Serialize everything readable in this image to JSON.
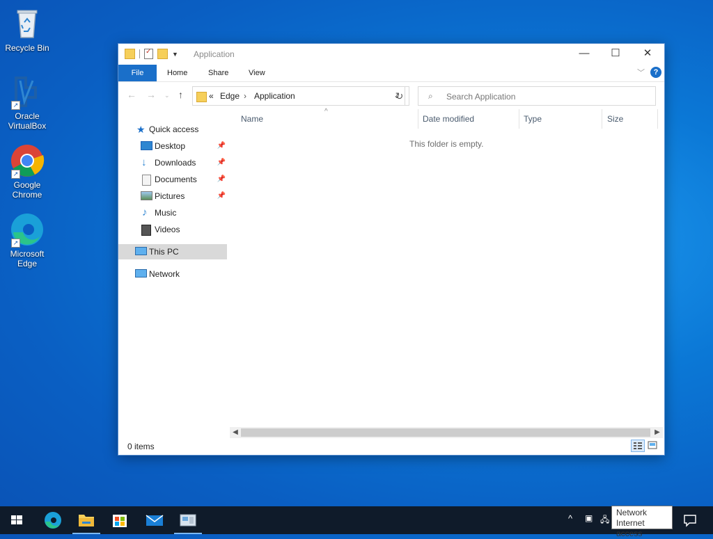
{
  "desktop": {
    "icons": [
      {
        "label": "Recycle Bin"
      },
      {
        "label": "Oracle VirtualBox"
      },
      {
        "label": "Google Chrome"
      },
      {
        "label": "Microsoft Edge"
      }
    ]
  },
  "window": {
    "title": "Application",
    "ribbon_tabs": [
      "File",
      "Home",
      "Share",
      "View"
    ],
    "help": "?",
    "address": {
      "overflow": "«",
      "crumbs": [
        "Edge",
        "Application"
      ]
    },
    "search": {
      "placeholder": "Search Application"
    },
    "nav": {
      "quick_access": "Quick access",
      "items": [
        "Desktop",
        "Downloads",
        "Documents",
        "Pictures",
        "Music",
        "Videos"
      ],
      "this_pc": "This PC",
      "network": "Network"
    },
    "columns": [
      "Name",
      "Date modified",
      "Type",
      "Size"
    ],
    "empty_message": "This folder is empty.",
    "status": "0 items"
  },
  "tooltip": {
    "line1": "Network",
    "line2": "Internet access"
  },
  "colors": {
    "accent": "#1a6fc9",
    "folder": "#f6cf5a",
    "taskbar": "#0f1b2a"
  }
}
